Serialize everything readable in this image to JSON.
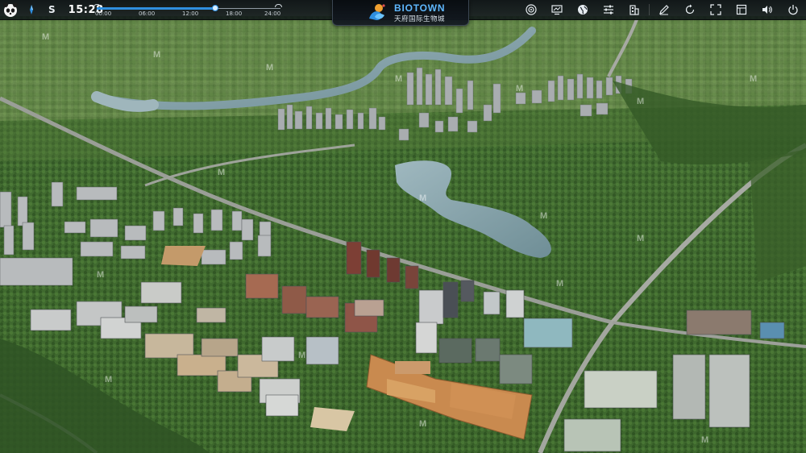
{
  "header": {
    "direction": "S",
    "time": "15:28",
    "timeline": {
      "ticks": [
        "00:00",
        "06:00",
        "12:00",
        "18:00",
        "24:00"
      ],
      "current_fraction": 0.645
    }
  },
  "brand": {
    "name": "BIOTOWN",
    "subtitle": "天府国际生物城",
    "accent": "#2f8fe0"
  },
  "toolbar": {
    "items": [
      {
        "name": "target-icon"
      },
      {
        "name": "monitor-chart-icon"
      },
      {
        "name": "globe-icon"
      },
      {
        "name": "sliders-icon"
      },
      {
        "name": "building-icon"
      },
      {
        "name": "pen-icon"
      },
      {
        "name": "rotate-icon"
      },
      {
        "name": "fullscreen-icon"
      },
      {
        "name": "panel-icon"
      },
      {
        "name": "sound-icon"
      },
      {
        "name": "power-icon"
      }
    ]
  }
}
